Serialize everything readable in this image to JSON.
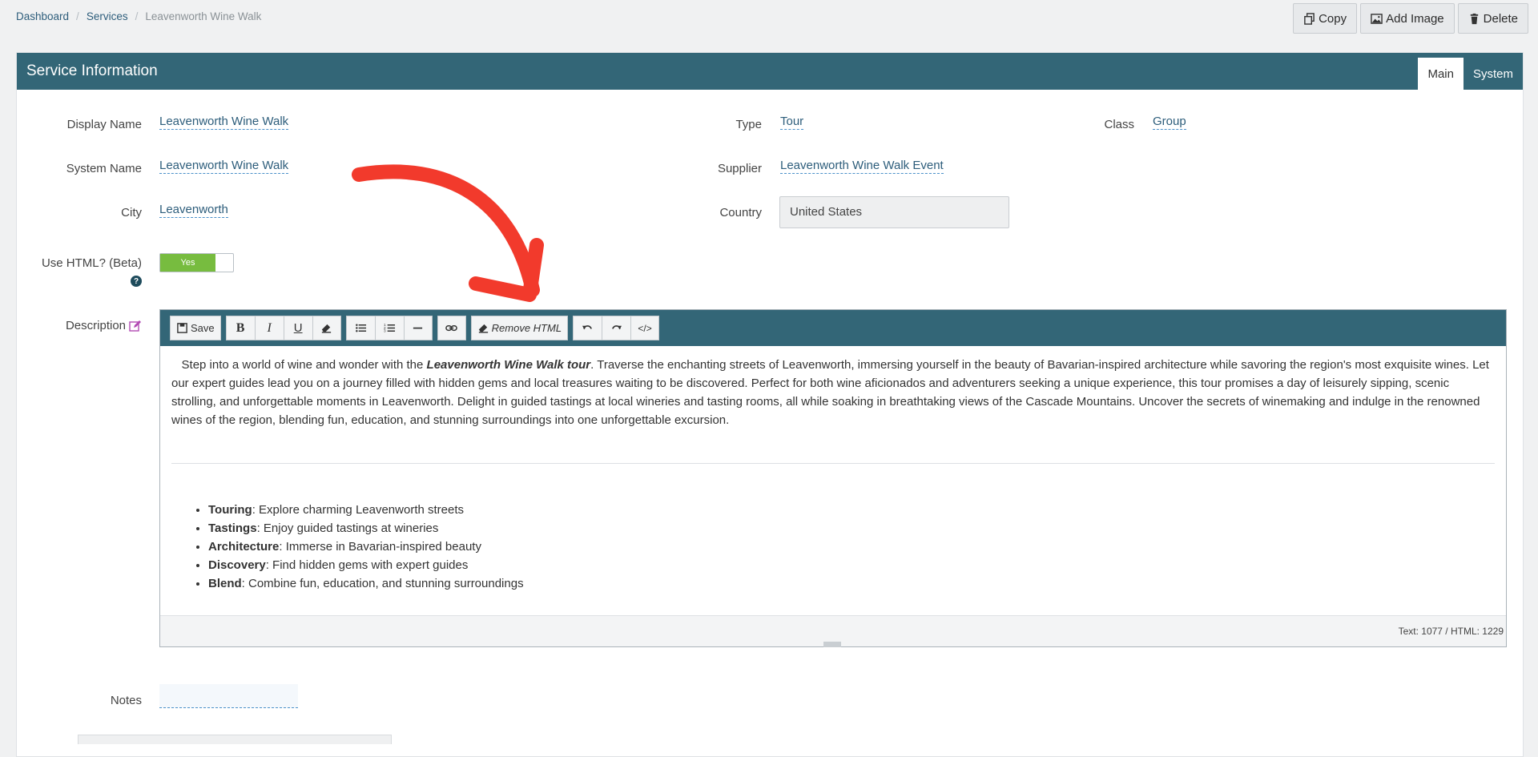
{
  "breadcrumb": {
    "items": [
      "Dashboard",
      "Services"
    ],
    "current": "Leavenworth Wine Walk"
  },
  "actions": {
    "copy": "Copy",
    "add_image": "Add Image",
    "delete": "Delete"
  },
  "panel": {
    "title": "Service Information",
    "tabs": [
      "Main",
      "System"
    ],
    "active_tab": "Main"
  },
  "fields": {
    "display_name": {
      "label": "Display Name",
      "value": "Leavenworth Wine Walk"
    },
    "system_name": {
      "label": "System Name",
      "value": "Leavenworth Wine Walk"
    },
    "city": {
      "label": "City",
      "value": "Leavenworth"
    },
    "use_html": {
      "label": "Use HTML? (Beta)",
      "value": "Yes"
    },
    "description": {
      "label": "Description"
    },
    "type": {
      "label": "Type",
      "value": "Tour"
    },
    "supplier": {
      "label": "Supplier",
      "value": "Leavenworth Wine Walk Event"
    },
    "country": {
      "label": "Country",
      "value": "United States"
    },
    "class": {
      "label": "Class",
      "value": "Group"
    },
    "notes": {
      "label": "Notes",
      "value": ""
    }
  },
  "editor": {
    "toolbar": {
      "save": "Save",
      "remove_html": "Remove HTML"
    },
    "intro_pre": "Step into a world of wine and wonder with the ",
    "intro_em": "Leavenworth Wine Walk tour",
    "intro_post": ". Traverse the enchanting streets of Leavenworth, immersing yourself in the beauty of Bavarian-inspired architecture while savoring the region's most exquisite wines. Let our expert guides lead you on a journey filled with hidden gems and local treasures waiting to be discovered. Perfect for both wine aficionados and adventurers seeking a unique experience, this tour promises a day of leisurely sipping, scenic strolling, and unforgettable moments in Leavenworth. Delight in guided tastings at local wineries and tasting rooms, all while soaking in breathtaking views of the Cascade Mountains. Uncover the secrets of winemaking and indulge in the renowned wines of the region, blending fun, education, and stunning surroundings into one unforgettable excursion.",
    "bullets": [
      {
        "term": "Touring",
        "text": ": Explore charming Leavenworth streets"
      },
      {
        "term": "Tastings",
        "text": ": Enjoy guided tastings at wineries"
      },
      {
        "term": "Architecture",
        "text": ": Immerse in Bavarian-inspired beauty"
      },
      {
        "term": "Discovery",
        "text": ": Find hidden gems with expert guides"
      },
      {
        "term": "Blend",
        "text": ": Combine fun, education, and stunning surroundings"
      }
    ],
    "counter": "Text: 1077 / HTML: 1229"
  },
  "colors": {
    "header": "#336677",
    "toggle_on": "#77bc3f",
    "link": "#2d5d7b",
    "annotation_arrow": "#f23a2c"
  }
}
